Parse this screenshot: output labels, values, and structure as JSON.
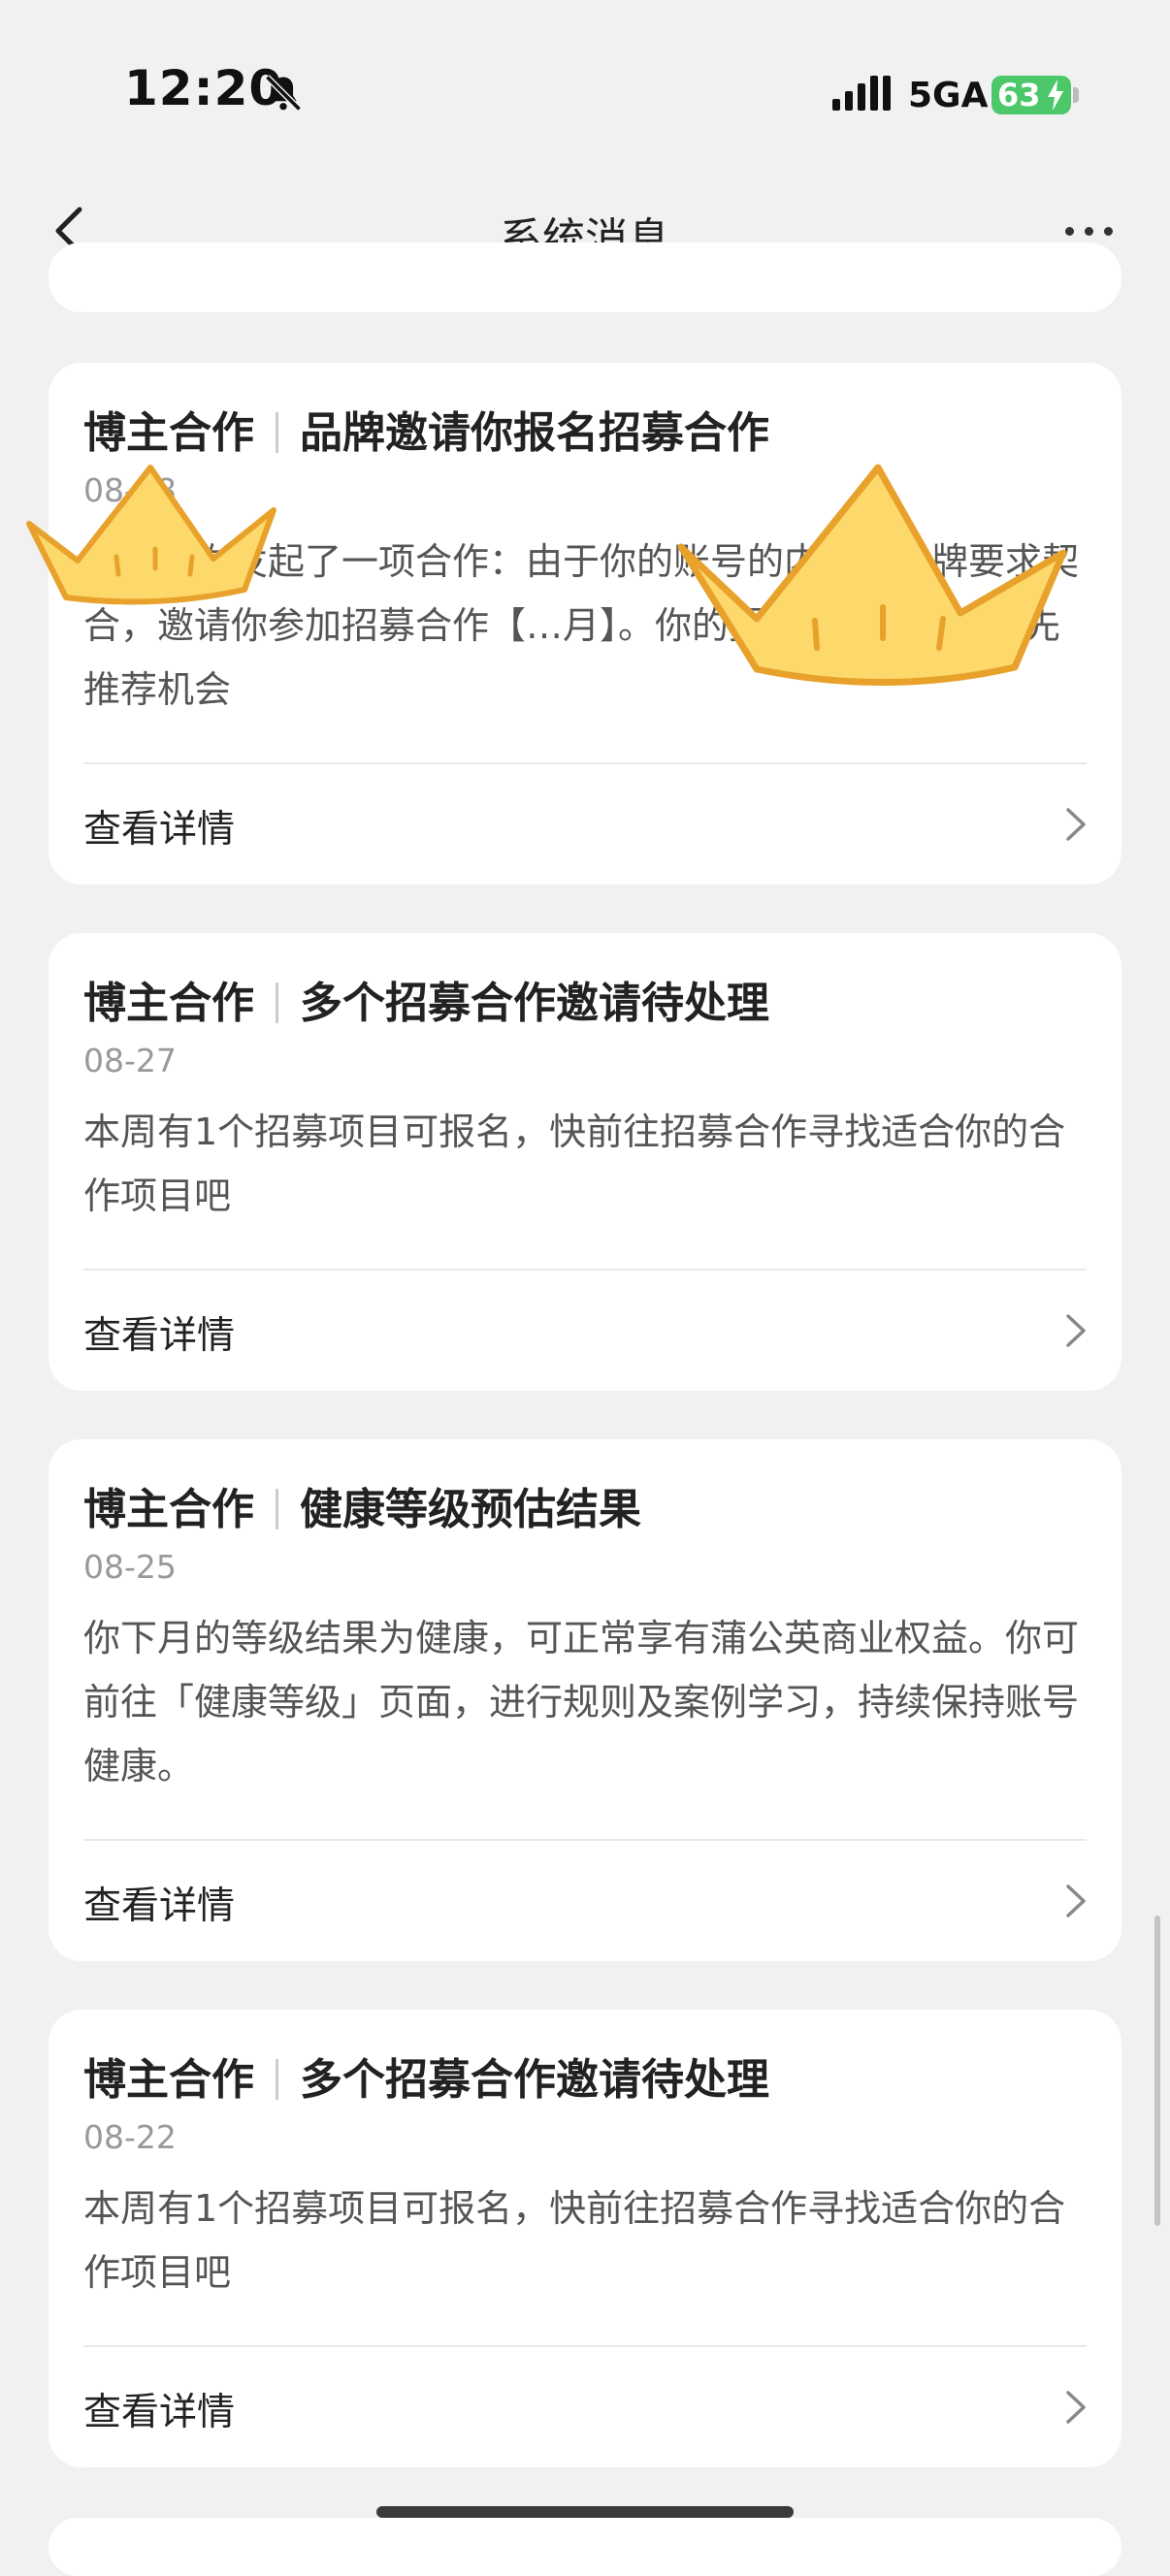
{
  "status_bar": {
    "time": "12:20",
    "network": "5GA",
    "battery": "63"
  },
  "nav": {
    "title": "系统消息"
  },
  "messages": [
    {
      "category": "博主合作",
      "title": "品牌邀请你报名招募合作",
      "date": "08-28",
      "body": "品牌向你发起了一项合作：由于你的账号的内容与品牌要求契合，邀请你参加招募合作【…月】。你的报名信息将获得优先推荐机会",
      "detail": "查看详情"
    },
    {
      "category": "博主合作",
      "title": "多个招募合作邀请待处理",
      "date": "08-27",
      "body": "本周有1个招募项目可报名，快前往招募合作寻找适合你的合作项目吧",
      "detail": "查看详情"
    },
    {
      "category": "博主合作",
      "title": "健康等级预估结果",
      "date": "08-25",
      "body": "你下月的等级结果为健康，可正常享有蒲公英商业权益。你可前往「健康等级」页面，进行规则及案例学习，持续保持账号健康。",
      "detail": "查看详情"
    },
    {
      "category": "博主合作",
      "title": "多个招募合作邀请待处理",
      "date": "08-22",
      "body": "本周有1个招募项目可报名，快前往招募合作寻找适合你的合作项目吧",
      "detail": "查看详情"
    }
  ],
  "icons": {
    "bell": "bell-muted-icon",
    "signal": "signal-icon",
    "back": "back-arrow-icon",
    "more": "more-dots-icon",
    "chevron": "chevron-right-icon",
    "sticker": "crown-sticker"
  },
  "colors": {
    "battery": "#4cc76a",
    "crown_fill": "#fdd86b",
    "crown_stroke": "#e8a22c"
  }
}
